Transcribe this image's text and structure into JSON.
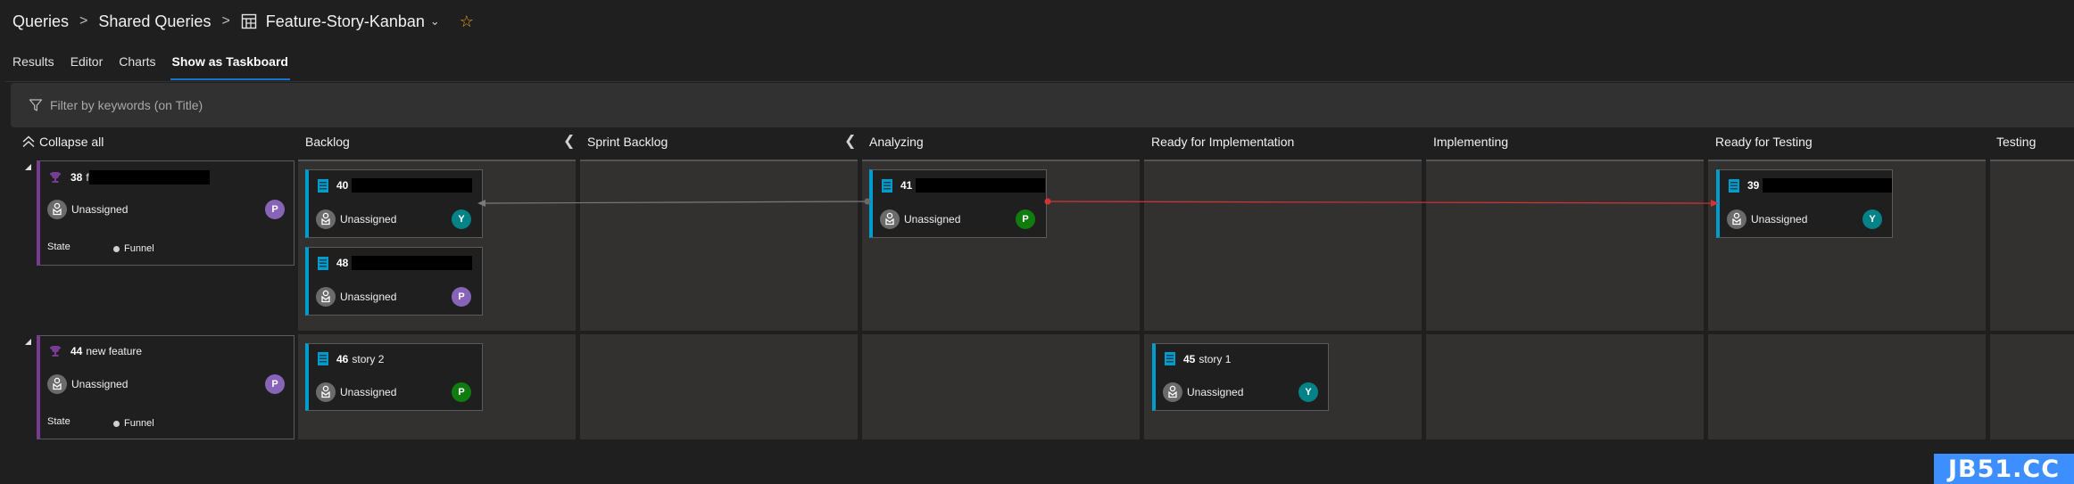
{
  "breadcrumb": {
    "items": [
      "Queries",
      "Shared Queries"
    ],
    "current": "Feature-Story-Kanban",
    "separator": ">",
    "icons": {
      "query": "table-query-icon",
      "dropdown": "chevron-down-icon",
      "favorite": "star-icon"
    }
  },
  "tabs": [
    {
      "label": "Results",
      "active": false
    },
    {
      "label": "Editor",
      "active": false
    },
    {
      "label": "Charts",
      "active": false
    },
    {
      "label": "Show as Taskboard",
      "active": true
    }
  ],
  "filter": {
    "placeholder": "Filter by keywords (on Title)",
    "value": ""
  },
  "board": {
    "collapse_all_label": "Collapse all",
    "columns": [
      {
        "name": "Backlog",
        "collapsible": true
      },
      {
        "name": "Sprint Backlog",
        "collapsible": true
      },
      {
        "name": "Analyzing",
        "collapsible": false
      },
      {
        "name": "Ready for Implementation",
        "collapsible": false
      },
      {
        "name": "Implementing",
        "collapsible": false
      },
      {
        "name": "Ready for Testing",
        "collapsible": false
      },
      {
        "name": "Testing",
        "collapsible": false
      }
    ],
    "rows": [
      {
        "feature": {
          "id": "38",
          "title": "f",
          "title_redacted": true,
          "assignee": "Unassigned",
          "avatar": "P",
          "state_label": "State",
          "state": "Funnel"
        },
        "cards": [
          {
            "id": "40",
            "title": "",
            "title_redacted": true,
            "column": "Backlog",
            "assignee": "Unassigned",
            "avatar": "Y"
          },
          {
            "id": "48",
            "title": "",
            "title_redacted": true,
            "column": "Backlog",
            "assignee": "Unassigned",
            "avatar": "P"
          },
          {
            "id": "41",
            "title": "",
            "title_redacted": true,
            "column": "Analyzing",
            "assignee": "Unassigned",
            "avatar": "P"
          },
          {
            "id": "39",
            "title": "",
            "title_redacted": true,
            "column": "Ready for Testing",
            "assignee": "Unassigned",
            "avatar": "Y"
          }
        ]
      },
      {
        "feature": {
          "id": "44",
          "title": "new feature",
          "title_redacted": false,
          "assignee": "Unassigned",
          "avatar": "P",
          "state_label": "State",
          "state": "Funnel"
        },
        "cards": [
          {
            "id": "46",
            "title": "story 2",
            "title_redacted": false,
            "column": "Backlog",
            "assignee": "Unassigned",
            "avatar": "P"
          },
          {
            "id": "45",
            "title": "story 1",
            "title_redacted": false,
            "column": "Ready for Implementation",
            "assignee": "Unassigned",
            "avatar": "Y"
          }
        ]
      }
    ],
    "links": [
      {
        "from": "41",
        "to": "40",
        "type": "predecessor",
        "color": "#7a7a7a"
      },
      {
        "from": "41",
        "to": "39",
        "type": "successor",
        "color": "#d13438"
      }
    ]
  },
  "colors": {
    "feature": "#773b93",
    "story": "#009ccc",
    "avatar_P_purple": "#8764b8",
    "avatar_P_green": "#107c10",
    "avatar_Y": "#038387",
    "accent": "#1b75c9",
    "star": "#e8a317"
  },
  "watermark": "JB51.CC"
}
